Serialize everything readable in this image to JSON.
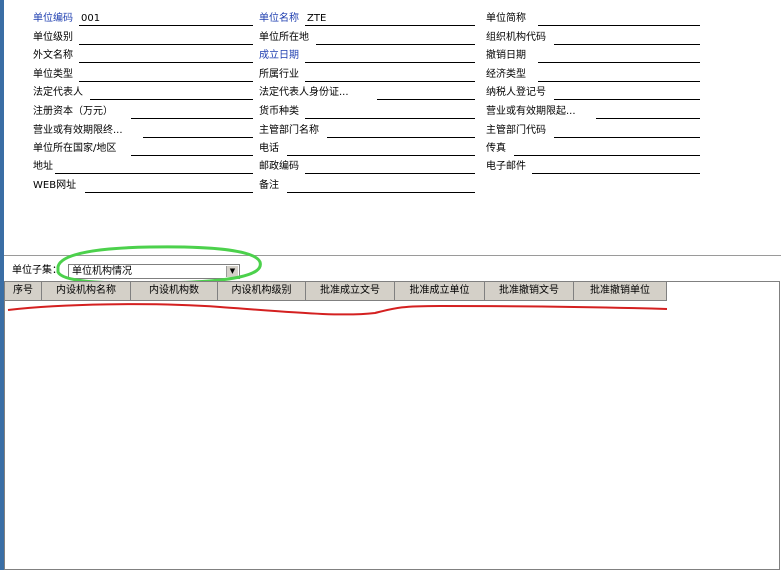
{
  "form": {
    "fields": [
      {
        "label": "单位编码",
        "value": "001",
        "required": true
      },
      {
        "label": "单位名称",
        "value": "ZTE",
        "required": true
      },
      {
        "label": "单位简称",
        "value": ""
      },
      {
        "label": "单位级别",
        "value": ""
      },
      {
        "label": "单位所在地",
        "value": ""
      },
      {
        "label": "组织机构代码",
        "value": ""
      },
      {
        "label": "外文名称",
        "value": ""
      },
      {
        "label": "成立日期",
        "value": "",
        "required": true
      },
      {
        "label": "撤销日期",
        "value": ""
      },
      {
        "label": "单位类型",
        "value": ""
      },
      {
        "label": "所属行业",
        "value": ""
      },
      {
        "label": "经济类型",
        "value": ""
      },
      {
        "label": "法定代表人",
        "value": ""
      },
      {
        "label": "法定代表人身份证...",
        "value": ""
      },
      {
        "label": "纳税人登记号",
        "value": ""
      },
      {
        "label": "注册资本（万元）",
        "value": ""
      },
      {
        "label": "货币种类",
        "value": ""
      },
      {
        "label": "营业或有效期限起...",
        "value": ""
      },
      {
        "label": "营业或有效期限终...",
        "value": ""
      },
      {
        "label": "主管部门名称",
        "value": ""
      },
      {
        "label": "主管部门代码",
        "value": ""
      },
      {
        "label": "单位所在国家/地区",
        "value": ""
      },
      {
        "label": "电话",
        "value": ""
      },
      {
        "label": "传真",
        "value": ""
      },
      {
        "label": "地址",
        "value": ""
      },
      {
        "label": "邮政编码",
        "value": ""
      },
      {
        "label": "电子邮件",
        "value": ""
      },
      {
        "label": "WEB网址",
        "value": ""
      },
      {
        "label": "备注",
        "value": ""
      }
    ]
  },
  "subset": {
    "label": "单位子集：",
    "selected": "单位机构情况"
  },
  "grid": {
    "columns": [
      "序号",
      "内设机构名称",
      "内设机构数",
      "内设机构级别",
      "批准成立文号",
      "批准成立单位",
      "批准撤销文号",
      "批准撤销单位"
    ]
  },
  "colors": {
    "required_label": "#1f3fb0",
    "annotation_green": "#4cd14c",
    "annotation_red": "#d42020",
    "header_bg": "#d4d0c8"
  }
}
